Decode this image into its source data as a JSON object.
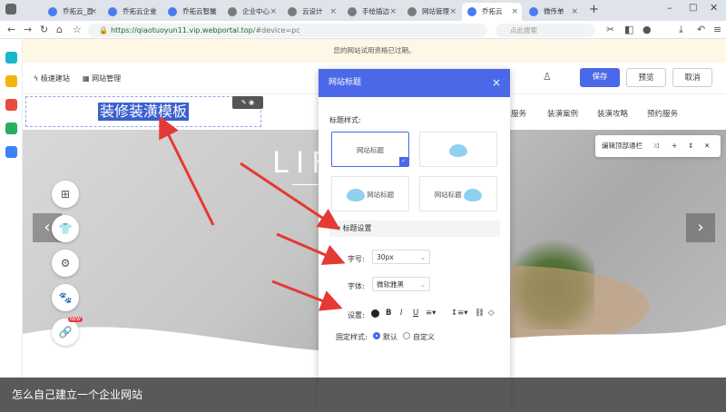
{
  "browser": {
    "tabs": [
      {
        "label": "乔拓云_直",
        "active": false
      },
      {
        "label": "乔拓云企业",
        "active": false
      },
      {
        "label": "乔拓云智能",
        "active": false
      },
      {
        "label": "企业中心",
        "active": false
      },
      {
        "label": "云设计",
        "active": false
      },
      {
        "label": "手绘插边",
        "active": false
      },
      {
        "label": "网站管理",
        "active": false
      },
      {
        "label": "乔拓云",
        "active": true
      },
      {
        "label": "微传单",
        "active": false
      }
    ],
    "url_scheme": "https://",
    "url_host": "qiaotuoyun11.vip.webportal.top",
    "url_path": "/#device=pc",
    "search_placeholder": "点此搜索"
  },
  "notice": "您的网站试用资格已过期。",
  "toolbar": {
    "quick_build": "极速建站",
    "site_manage": "网站管理",
    "save": "保存",
    "preview": "预览",
    "cancel": "取消"
  },
  "canvas": {
    "site_title": "装修装潢模板",
    "menu": [
      "服务",
      "装潢案例",
      "装潢攻略",
      "预约服务"
    ],
    "hero_text": "LIF",
    "topnav_popup": "编辑顶部通栏"
  },
  "panel": {
    "title": "网站标题",
    "style_label": "标题样式:",
    "style_cards": [
      "网站标题",
      "",
      "网站标题",
      "网站标题"
    ],
    "section_label": "标题设置",
    "font_size_label": "字号:",
    "font_size_value": "30px",
    "font_family_label": "字体:",
    "font_family_value": "微软雅黑",
    "settings_label": "设置:",
    "fixed_style_label": "固定样式:",
    "radio_default": "默认",
    "radio_custom": "自定义"
  },
  "caption": "怎么自己建立一个企业网站",
  "colors": {
    "accent": "#4a68e8",
    "arrow": "#e53935",
    "selection": "#3b5fcf"
  }
}
